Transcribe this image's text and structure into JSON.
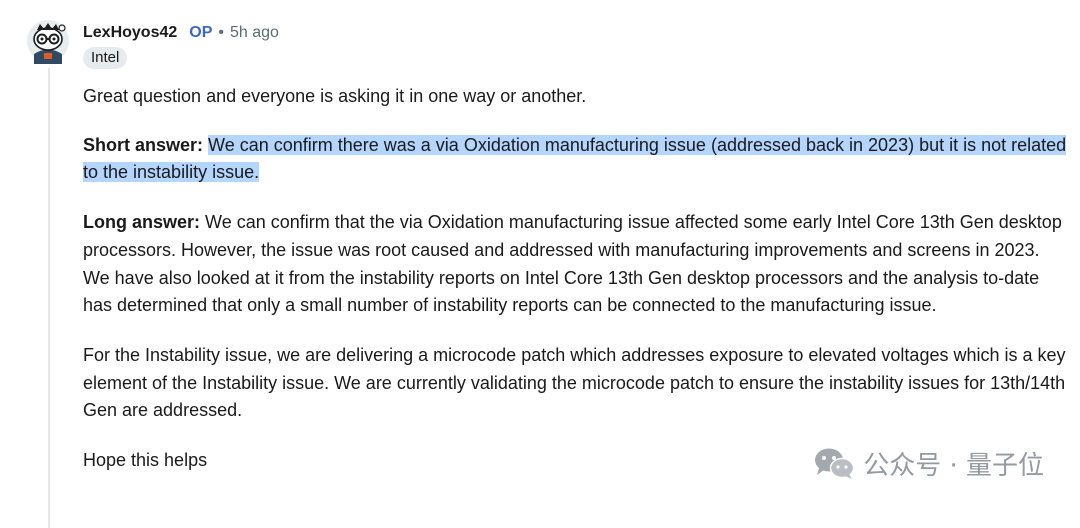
{
  "comment": {
    "username": "LexHoyos42",
    "op_badge": "OP",
    "separator": "•",
    "time_ago": "5h ago",
    "flair": "Intel",
    "paragraphs": {
      "p1": "Great question and everyone is asking it in one way or another.",
      "p2_label": "Short answer:",
      "p2_text": "We can confirm there was a via Oxidation manufacturing issue (addressed back in 2023) but it is not related to the instability issue.",
      "p3_label": "Long answer:",
      "p3_text": "We can confirm that the via Oxidation manufacturing issue affected some early Intel Core 13th Gen desktop processors. However, the issue was root caused and addressed with manufacturing improvements and screens in 2023. We have also looked at it from the instability reports on Intel Core 13th Gen desktop processors and the analysis to-date has determined that only a small number of instability reports can be connected to the manufacturing issue.",
      "p4": "For the Instability issue, we are delivering a microcode patch which addresses exposure to elevated voltages which is a key element of the Instability issue. We are currently validating the microcode patch to ensure the instability issues for 13th/14th Gen are addressed.",
      "p5": "Hope this helps"
    }
  },
  "watermark": {
    "text": "公众号 · 量子位",
    "icon": "wechat-icon"
  },
  "colors": {
    "op": "#3b66c4",
    "highlight": "#b4d5fe",
    "flair_bg": "#e5ebee",
    "meta": "#576f76"
  }
}
